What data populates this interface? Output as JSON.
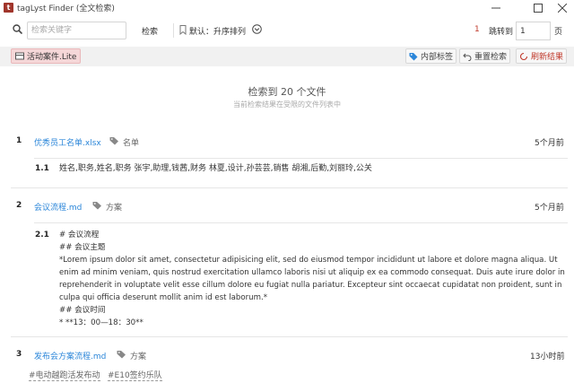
{
  "window": {
    "title": "tagLyst Finder (全文检索)",
    "icon_letter": "t",
    "controls": {
      "minimize": "—",
      "maximize": "☐",
      "close": "✕"
    }
  },
  "search": {
    "placeholder": "检索关键字",
    "value": "",
    "button_label": "检索",
    "sort_label": "默认：升序排列"
  },
  "pagination": {
    "current": "1",
    "jump_label": "跳转到",
    "input_value": "1",
    "suffix": "页"
  },
  "toolbar": {
    "case_label": "活动案件.Lite",
    "tags_label": "内部标签",
    "reset_label": "重置检索",
    "refresh_label": "刷新结果"
  },
  "summary": {
    "count_text": "检索到 20 个文件",
    "subtitle": "当前检索结果在受限的文件列表中"
  },
  "results": [
    {
      "num": "1",
      "file": "优秀员工名单.xlsx",
      "tag": "名单",
      "time": "5个月前",
      "subs": [
        {
          "num": "1.1",
          "text": "姓名,职务,姓名,职务 张宇,助理,钱茜,财务 林夏,设计,孙芸芸,销售 胡湘,后勤,刘丽玲,公关"
        }
      ]
    },
    {
      "num": "2",
      "file": "会议流程.md",
      "tag": "方案",
      "time": "5个月前",
      "subs": [
        {
          "num": "2.1",
          "lines": [
            "# 会议流程",
            "## 会议主题",
            "*Lorem ipsum dolor sit amet, consectetur adipisicing elit, sed do eiusmod tempor incididunt ut labore et dolore magna aliqua. Ut enim ad minim veniam, quis nostrud exercitation ullamco laboris nisi ut aliquip ex ea commodo consequat. Duis aute irure dolor in reprehenderit in voluptate velit esse cillum dolore eu fugiat nulla pariatur. Excepteur sint occaecat cupidatat non proident, sunt in culpa qui officia deserunt mollit anim id est laborum.*",
            "## 会议时间",
            "* **13：00—18：30**"
          ]
        }
      ]
    },
    {
      "num": "3",
      "file": "发布会方案流程.md",
      "tag": "方案",
      "time": "13小时前",
      "hashtags": [
        "#电动越跑活发布动",
        "#E10签约乐队"
      ]
    }
  ],
  "colors": {
    "accent_red": "#c0392b",
    "link_blue": "#2b86d9",
    "case_tag_bg": "#f5d7d8"
  }
}
